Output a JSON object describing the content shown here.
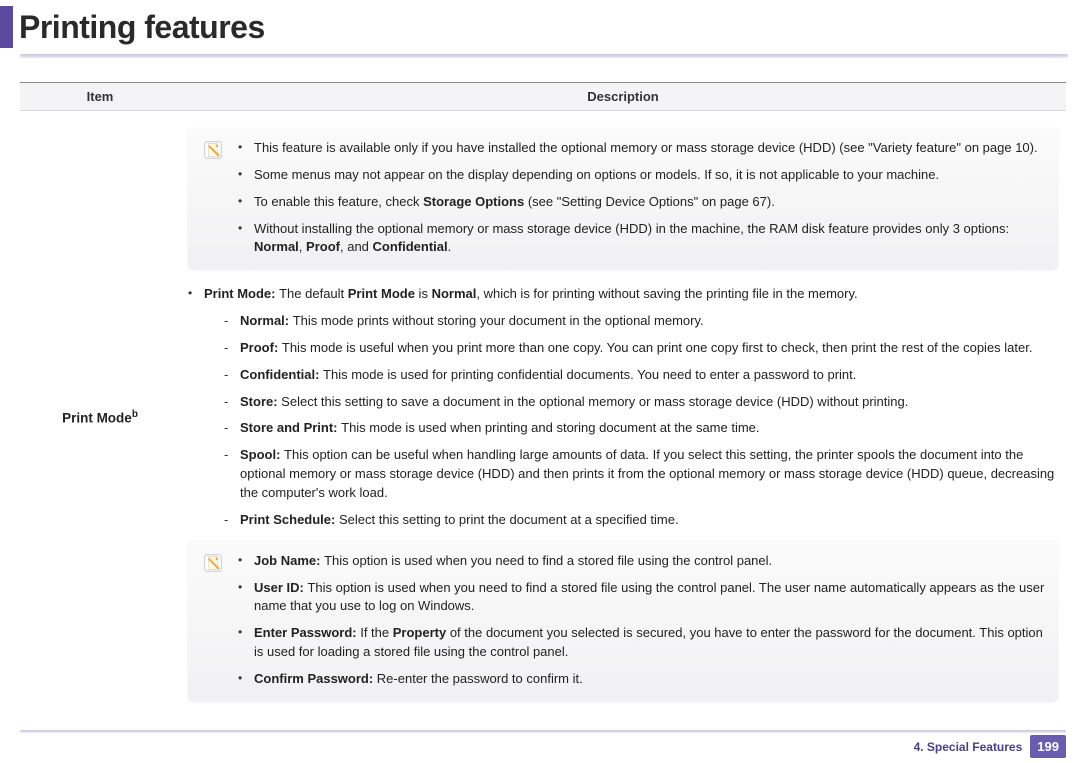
{
  "title": "Printing features",
  "table": {
    "headers": {
      "item": "Item",
      "desc": "Description"
    },
    "row_label": "Print Mode",
    "row_label_sup": "b"
  },
  "note1": {
    "b1": "This feature is available only if you have installed the optional memory or mass storage device (HDD) (see \"Variety feature\" on page 10).",
    "b2": "Some menus may not appear on the display depending on options or models. If so, it is not applicable to your machine.",
    "b3_pre": "To enable this feature, check ",
    "b3_bold": "Storage Options ",
    "b3_post": "(see \"Setting Device Options\" on page 67).",
    "b4_pre": "Without installing the optional memory or mass storage device (HDD) in the machine, the RAM disk feature provides only 3 options: ",
    "b4_b1": "Normal",
    "b4_sep1": ", ",
    "b4_b2": "Proof",
    "b4_sep2": ", and ",
    "b4_b3": "Confidential",
    "b4_end": "."
  },
  "pm": {
    "lead_b1": "Print Mode: ",
    "lead_t1": "The default ",
    "lead_b2": "Print Mode",
    "lead_t2": " is ",
    "lead_b3": "Normal",
    "lead_t3": ", which is for printing without saving the printing file in the memory.",
    "normal_b": "Normal: ",
    "normal_t": "This mode prints without storing your document in the optional memory.",
    "proof_b": "Proof: ",
    "proof_t": "This mode is useful when you print more than one copy. You can print one copy first to check, then print the rest of the copies later.",
    "conf_b": "Confidential: ",
    "conf_t": "This mode is used for printing confidential documents. You need to enter a password to print.",
    "store_b": "Store: ",
    "store_t": "Select this setting to save a document in the optional memory or mass storage device (HDD) without printing.",
    "sap_b": "Store and Print: ",
    "sap_t": "This mode is used when printing and storing document at the same time.",
    "spool_b": "Spool: ",
    "spool_t": "This option can be useful when handling large amounts of data. If you select this setting, the printer spools the document into the optional memory or mass storage device (HDD) and then prints it from the optional memory or mass storage device (HDD) queue, decreasing the computer's work load.",
    "sched_b": "Print Schedule: ",
    "sched_t": "Select this setting to print the document at a specified time."
  },
  "note2": {
    "jn_b": "Job Name: ",
    "jn_t": "This option is used when you need to find a stored file using the control panel.",
    "uid_b": "User ID: ",
    "uid_t": "This option is used when you need to find a stored file using the control panel. The user name automatically appears as the user name that you use to log on Windows.",
    "ep_b": "Enter Password: ",
    "ep_t1": "If the ",
    "ep_b2": "Property",
    "ep_t2": " of the document you selected is secured, you have to enter the password for the document.  This option is used for loading a stored file using the control panel.",
    "cp_b": "Confirm Password: ",
    "cp_t": "Re-enter the password to confirm it."
  },
  "footer": {
    "chapter": "4.  Special Features",
    "page": "199"
  }
}
